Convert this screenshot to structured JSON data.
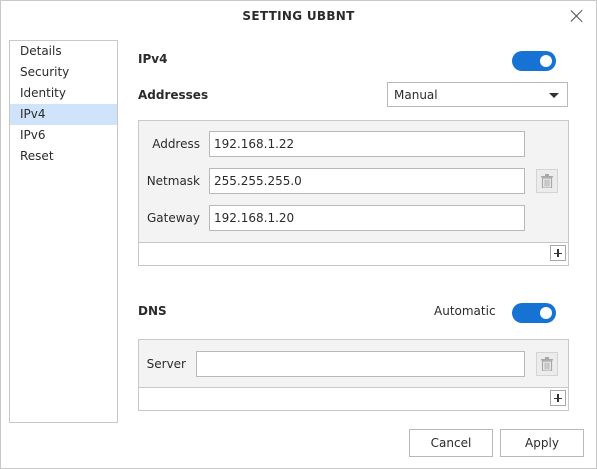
{
  "window": {
    "title": "SETTING UBBNT"
  },
  "sidebar": {
    "items": [
      {
        "label": "Details"
      },
      {
        "label": "Security"
      },
      {
        "label": "Identity"
      },
      {
        "label": "IPv4",
        "active": true
      },
      {
        "label": "IPv6"
      },
      {
        "label": "Reset"
      }
    ]
  },
  "ipv4": {
    "title": "IPv4",
    "enabled": true,
    "addresses_label": "Addresses",
    "method": "Manual",
    "fields": {
      "address_label": "Address",
      "address_value": "192.168.1.22",
      "netmask_label": "Netmask",
      "netmask_value": "255.255.255.0",
      "gateway_label": "Gateway",
      "gateway_value": "192.168.1.20"
    }
  },
  "dns": {
    "title": "DNS",
    "auto_label": "Automatic",
    "automatic": true,
    "server_label": "Server",
    "server_value": ""
  },
  "buttons": {
    "cancel": "Cancel",
    "apply": "Apply"
  },
  "colors": {
    "accent": "#1673d4",
    "selection": "#cfe4fa"
  }
}
